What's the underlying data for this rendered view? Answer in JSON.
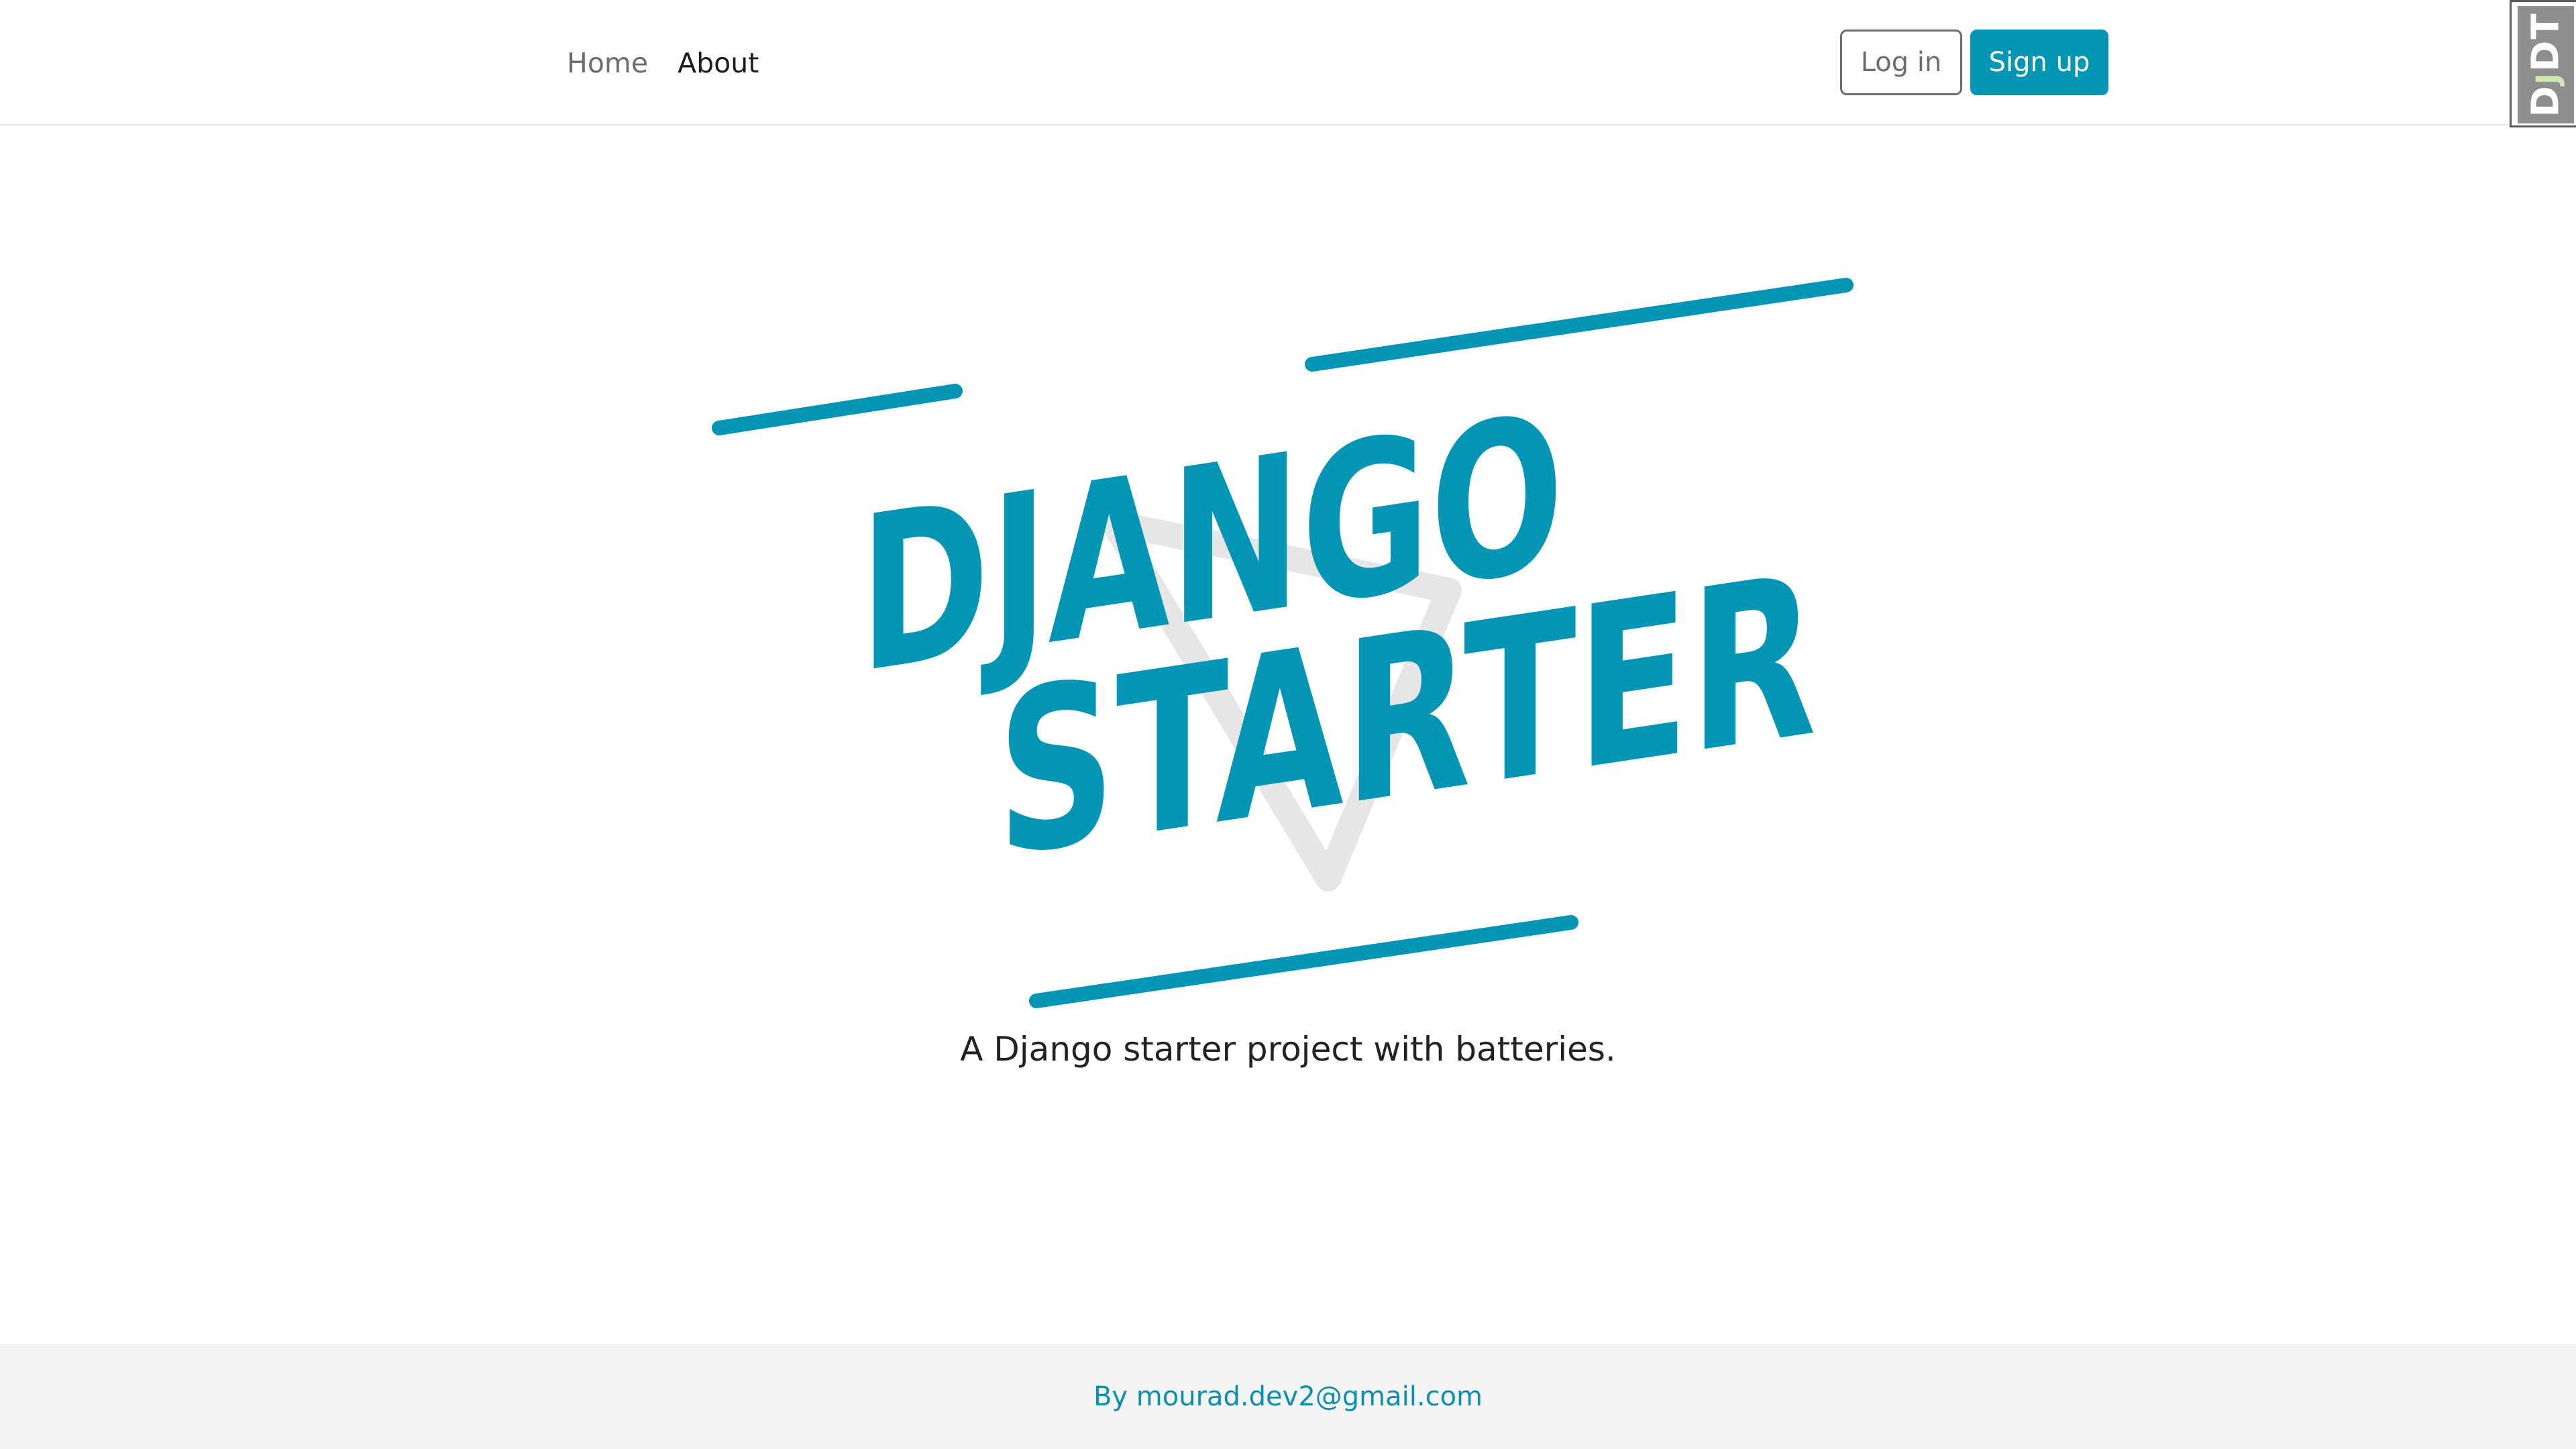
{
  "nav": {
    "links": [
      {
        "label": "Home",
        "active": false
      },
      {
        "label": "About",
        "active": true
      }
    ],
    "login_label": "Log in",
    "signup_label": "Sign up"
  },
  "debug_toolbar": {
    "handle_d": "D",
    "handle_j": "J",
    "handle_dt": "DT"
  },
  "hero": {
    "logo_line1": "DJANGO",
    "logo_line2": "STARTER",
    "tagline": "A Django starter project with batteries."
  },
  "footer": {
    "credit": "By mourad.dev2@gmail.com"
  },
  "colors": {
    "brand": "#0596b6",
    "footer_bg": "#f4f4f4",
    "text": "#222222"
  }
}
